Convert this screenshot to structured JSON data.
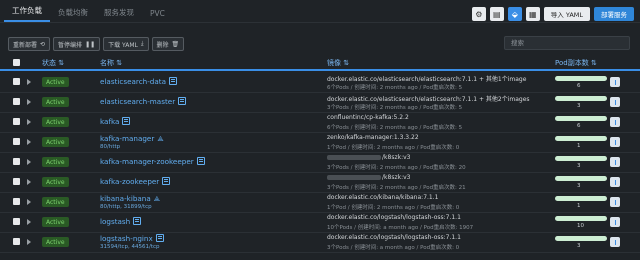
{
  "tabs": [
    "工作负载",
    "负载均衡",
    "服务发现",
    "PVC"
  ],
  "top_buttons": {
    "import": "导入 YAML",
    "deploy": "部署服务"
  },
  "actions": [
    "重新部署",
    "暂停编排",
    "下载 YAML",
    "删除"
  ],
  "search": {
    "placeholder": "搜索"
  },
  "columns": {
    "state": "状态",
    "name": "名称",
    "image": "镜像",
    "pods": "Pod副本数"
  },
  "rows": [
    {
      "state": "Active",
      "name": "elasticsearch-data",
      "sub": "",
      "image": "docker.elastic.co/elasticsearch/elasticsearch:7.1.1 + 其他1个image",
      "image_prefix": "",
      "meta": "6个Pods / 创建时间: 2 months ago / Pod重启次数: 5",
      "pods": "6"
    },
    {
      "state": "Active",
      "name": "elasticsearch-master",
      "sub": "",
      "image": "docker.elastic.co/elasticsearch/elasticsearch:7.1.1 + 其他2个images",
      "image_prefix": "",
      "meta": "3个Pods / 创建时间: 2 months ago / Pod重启次数: 5",
      "pods": "3"
    },
    {
      "state": "Active",
      "name": "kafka",
      "sub": "",
      "image": "confluentinc/cp-kafka:5.2.2",
      "image_prefix": "",
      "meta": "6个Pods / 创建时间: 2 months ago / Pod重启次数: 5",
      "pods": "6"
    },
    {
      "state": "Active",
      "name": "kafka-manager",
      "sub": "80/http",
      "image": "zenko/kafka-manager:1.3.3.22",
      "image_prefix": "",
      "meta": "1个Pod / 创建时间: 2 months ago / Pod重启次数: 0",
      "pods": "1"
    },
    {
      "state": "Active",
      "name": "kafka-manager-zookeeper",
      "sub": "",
      "image": "/k8szk:v3",
      "image_prefix": "",
      "meta": "3个Pods / 创建时间: 2 months ago / Pod重启次数: 20",
      "pods": "3"
    },
    {
      "state": "Active",
      "name": "kafka-zookeeper",
      "sub": "",
      "image": "/k8szk:v3",
      "image_prefix": "",
      "meta": "3个Pods / 创建时间: 2 months ago / Pod重启次数: 21",
      "pods": "3"
    },
    {
      "state": "Active",
      "name": "kibana-kibana",
      "sub": "80/http, 31899/tcp",
      "image": "docker.elastic.co/kibana/kibana:7.1.1",
      "image_prefix": "",
      "meta": "1个Pod / 创建时间: 2 months ago / Pod重启次数: 0",
      "pods": "1"
    },
    {
      "state": "Active",
      "name": "logstash",
      "sub": "",
      "image": "docker.elastic.co/logstash/logstash-oss:7.1.1",
      "image_prefix": "",
      "meta": "10个Pods / 创建时间: a month ago / Pod重启次数: 1907",
      "pods": "10"
    },
    {
      "state": "Active",
      "name": "logstash-nginx",
      "sub": "31594/tcp, 44561/tcp",
      "image": "docker.elastic.co/logstash/logstash-oss:7.1.1",
      "image_prefix": "",
      "meta": "3个Pods / 创建时间: a month ago / Pod重启次数: 0",
      "pods": "3"
    }
  ]
}
